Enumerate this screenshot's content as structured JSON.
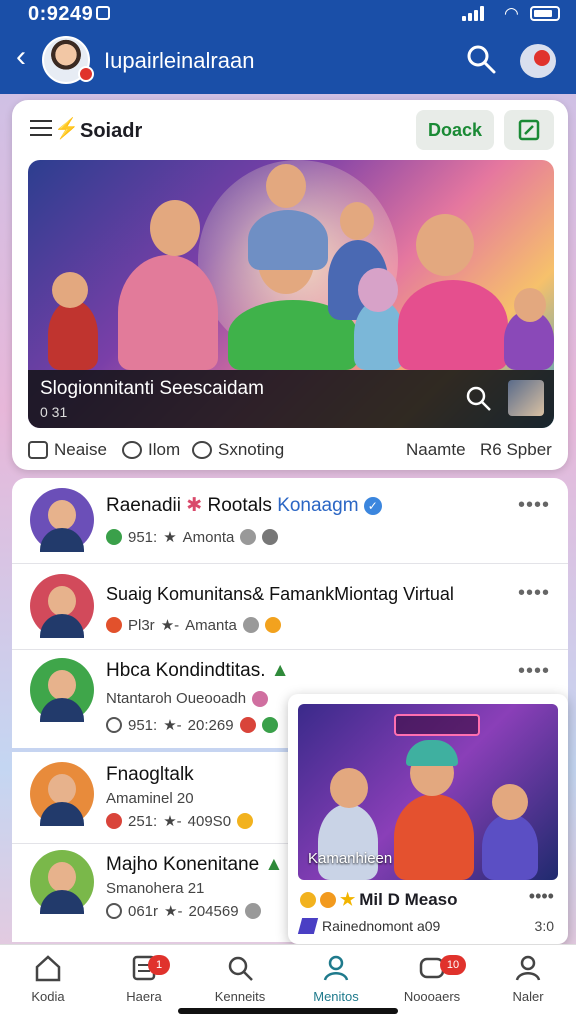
{
  "status_bar": {
    "time": "0:9249"
  },
  "header": {
    "title": "Iupairleinalraan"
  },
  "featured": {
    "title": "Soiadr",
    "primary_button": "Doack",
    "hero_caption": "Slogionnitanti Seescaidam",
    "hero_meta": "0 31",
    "actions": [
      {
        "label": "Neaise",
        "icon": "square-icon"
      },
      {
        "label": "Ilom",
        "icon": "comment-icon"
      },
      {
        "label": "Sxnoting",
        "icon": "share-bubble-icon"
      }
    ],
    "right_actions": [
      "Naamte",
      "R6 Spber"
    ]
  },
  "list": [
    {
      "title": "Raenadii",
      "title_extra": "Rootals",
      "title_accent": "Konaagm",
      "meta_count": "951:",
      "meta_star": "★",
      "meta_text": "Amonta",
      "avatar_bg": "#6b4fb8"
    },
    {
      "title": "Suaig Komunitans& FamankMiontag Virtual",
      "meta_count": "Pl3r",
      "meta_star": "★-",
      "meta_text": "Amanta",
      "avatar_bg": "#d24a5b"
    },
    {
      "title": "Hbca Kondindtitas.",
      "meta_text": "Ntantaroh Oueooadh",
      "avatar_bg": "#3fa64a"
    }
  ],
  "list_tail": [
    {
      "title": "",
      "meta_count": "951:",
      "meta_star": "★-",
      "meta_text": "20:269"
    }
  ],
  "list2": [
    {
      "title": "Fnaogltalk",
      "subtitle": "Amaminel 20",
      "meta_count": "251:",
      "meta_star": "★-",
      "meta_text": "409S0",
      "avatar_bg": "#e88b3b"
    },
    {
      "title": "Majho Konenitane",
      "subtitle": "Smanohera 21",
      "meta_count": "061r",
      "meta_star": "★-",
      "meta_text": "204569",
      "avatar_bg": "#7ab84a"
    }
  ],
  "promo": {
    "caption": "Kamanhieen",
    "line1": "Mil D Measo",
    "line2": "Rainednomont a09",
    "time": "3:0"
  },
  "nav": [
    {
      "label": "Kodia",
      "icon": "home-icon",
      "badge": ""
    },
    {
      "label": "Haera",
      "icon": "document-icon",
      "badge": "1"
    },
    {
      "label": "Kenneits",
      "icon": "search-person-icon",
      "badge": ""
    },
    {
      "label": "Menitos",
      "icon": "person-icon",
      "badge": "",
      "active": true
    },
    {
      "label": "Noooaers",
      "icon": "message-icon",
      "badge": "10"
    },
    {
      "label": "Naler",
      "icon": "profile-icon",
      "badge": ""
    }
  ],
  "colors": {
    "appbar": "#1a4fa8",
    "accent_green": "#1a8a35",
    "active_nav": "#1f7a8c",
    "badge": "#e0322c"
  }
}
